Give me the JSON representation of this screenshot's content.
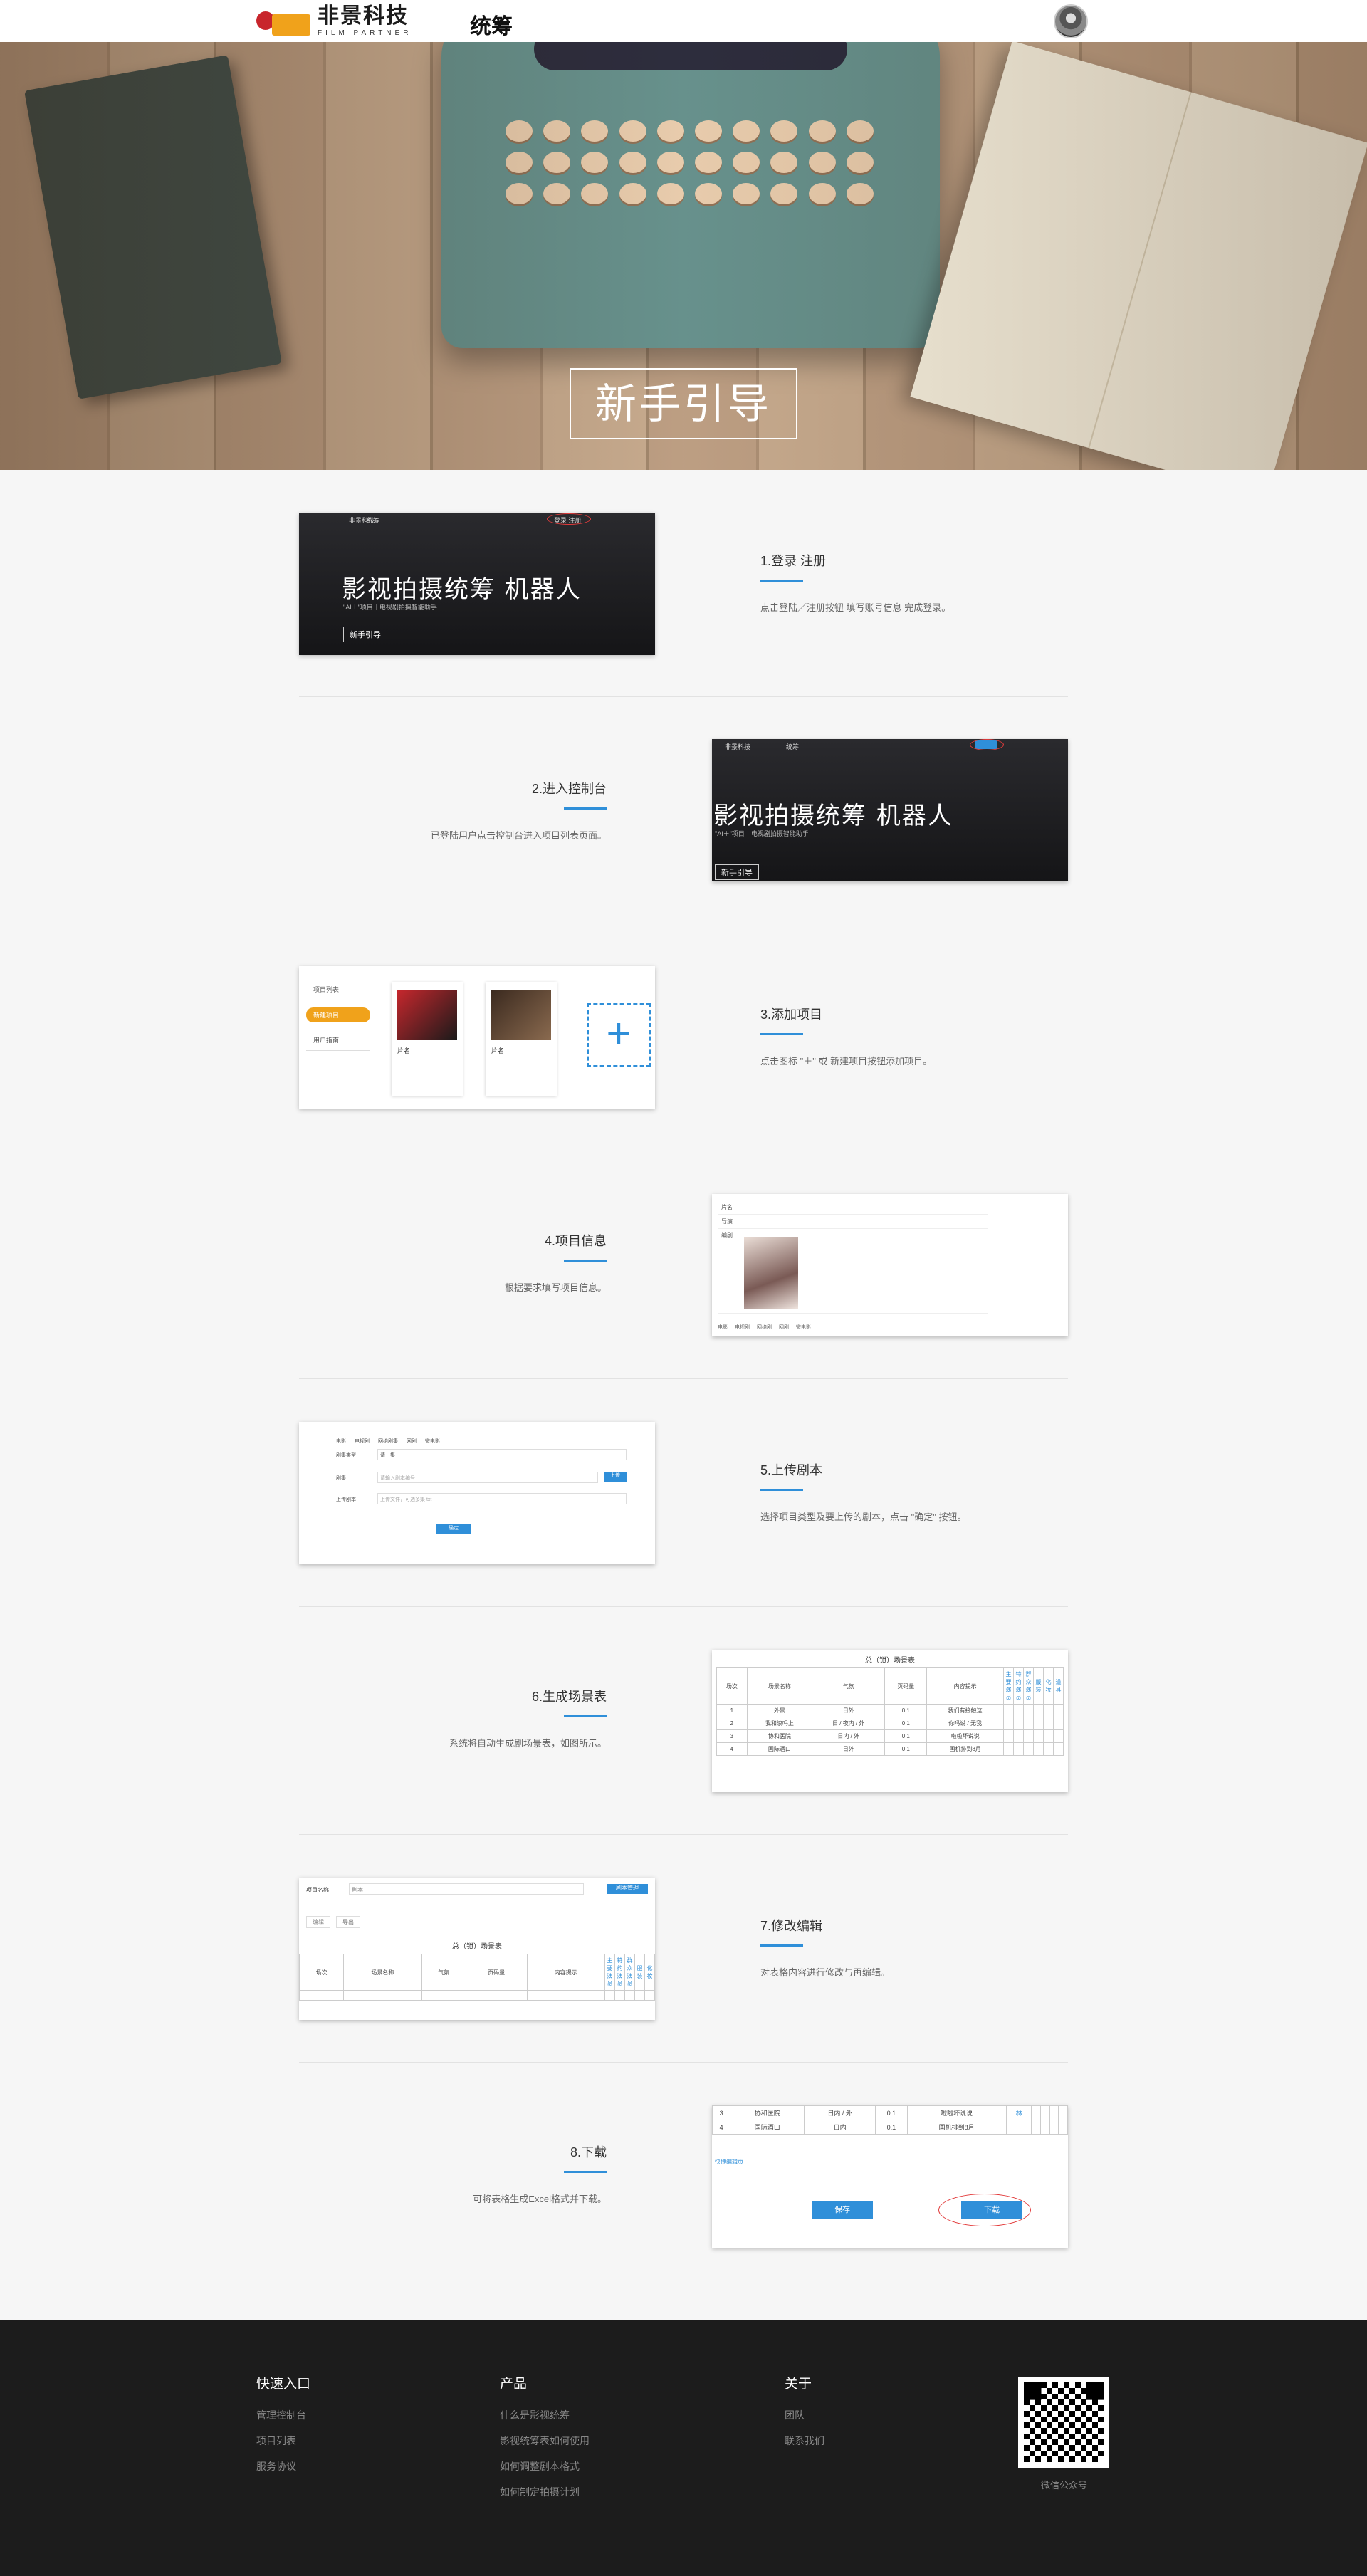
{
  "header": {
    "logo_cn": "非景科技",
    "logo_en": "FILM PARTNER",
    "nav_title": "统筹"
  },
  "hero": {
    "title": "新手引导"
  },
  "steps": [
    {
      "title": "1.登录  注册",
      "desc": "点击登陆／注册按钮 填写账号信息 完成登录。"
    },
    {
      "title": "2.进入控制台",
      "desc": "已登陆用户点击控制台进入项目列表页面。"
    },
    {
      "title": "3.添加项目",
      "desc": "点击图标 \"＋\" 或 新建项目按钮添加项目。"
    },
    {
      "title": "4.项目信息",
      "desc": "根据要求填写项目信息。"
    },
    {
      "title": "5.上传剧本",
      "desc": "选择项目类型及要上传的剧本，点击 \"确定\" 按钮。"
    },
    {
      "title": "6.生成场景表",
      "desc": "系统将自动生成剧场景表，如图所示。"
    },
    {
      "title": "7.修改编辑",
      "desc": "对表格内容进行修改与再编辑。"
    },
    {
      "title": "8.下载",
      "desc": "可将表格生成Excel格式并下载。"
    }
  ],
  "shots": {
    "banner_text": "影视拍摄统筹 机器人",
    "banner_sub": "\"AI＋\"项目｜电视剧拍摄智能助手",
    "banner_btn": "新手引导",
    "login_link": "登录 注册",
    "s1_nav": "统筹",
    "s3_menu": [
      "项目列表",
      "新建项目",
      "用户指南"
    ],
    "s3_card_title": "片名",
    "s3_plus": "+",
    "s4_fields": [
      "片名",
      "导演",
      "编剧"
    ],
    "s4_radios": [
      "电影",
      "电视剧",
      "网络剧",
      "网剧",
      "微电影"
    ],
    "s5_radios": [
      "电影",
      "电视剧",
      "网络剧集",
      "网剧",
      "微电影",
      "微电影片"
    ],
    "s5_labels": [
      "剧集类型",
      "剧集",
      "上传剧本"
    ],
    "s5_select": "请一集",
    "s5_placeholder": "请输入剧本编号",
    "s5_upload": "上传",
    "s5_file": "上传文件，可选多集 txt",
    "s5_confirm": "确定",
    "table_title": "总（锁）场景表",
    "table_headers": [
      "场次",
      "场景名称",
      "气氛",
      "页码量",
      "内容提示",
      "主要演员",
      "特约演员",
      "群众演员",
      "服装",
      "化妆",
      "道具",
      "特殊道具",
      "交通",
      "动物",
      "场景特效",
      "备注"
    ],
    "table_rows": [
      [
        "1",
        "外景",
        "日外",
        "0.1",
        "我们有接触这"
      ],
      [
        "2",
        "我和浪吗上",
        "日 / 夜内 / 外",
        "0.1",
        "你吗说 / 无我"
      ],
      [
        "3",
        "协和医院",
        "日内 / 外",
        "0.1",
        "啦啦坏说说"
      ],
      [
        "4",
        "国际酒口",
        "日外",
        "0.1",
        "国机排到8月"
      ]
    ],
    "s7_label": "项目名称",
    "s7_value": "剧本",
    "s7_btn": "剧本管理",
    "s7_tabs": [
      "编辑",
      "导出"
    ],
    "s8_rows": [
      [
        "3",
        "协和医院",
        "日内 / 外",
        "0.1",
        "啦啦坏说说",
        "林"
      ],
      [
        "4",
        "国际酒口",
        "日内",
        "0.1",
        "国机排到8月"
      ]
    ],
    "s8_link": "快捷编辑页",
    "s8_save": "保存",
    "s8_download": "下载"
  },
  "footer": {
    "columns": [
      {
        "title": "快速入口",
        "links": [
          "管理控制台",
          "项目列表",
          "服务协议"
        ]
      },
      {
        "title": "产品",
        "links": [
          "什么是影视统筹",
          "影视统筹表如何使用",
          "如何调整剧本格式",
          "如何制定拍摄计划"
        ]
      },
      {
        "title": "关于",
        "links": [
          "团队",
          "联系我们"
        ]
      }
    ],
    "qr_caption": "微信公众号"
  }
}
